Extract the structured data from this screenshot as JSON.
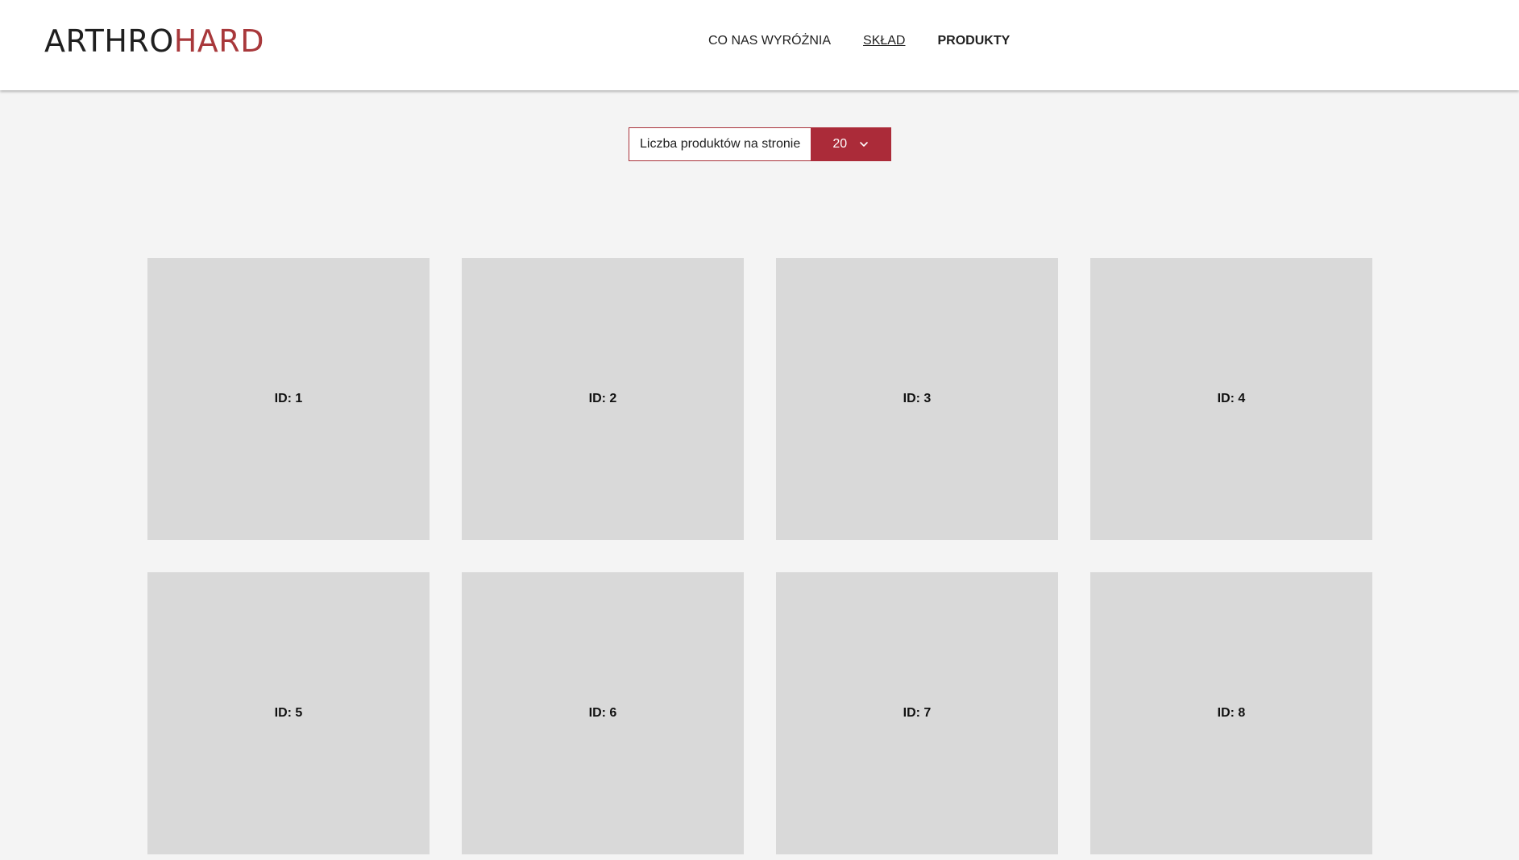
{
  "brand": {
    "logo_part_1": "ARTHRO",
    "logo_part_2": "HARD",
    "accent_color": "#a8383b"
  },
  "nav": {
    "items": [
      {
        "label": "CO NAS WYRÓŻNIA"
      },
      {
        "label": "SKŁAD"
      },
      {
        "label": "PRODUKTY"
      }
    ]
  },
  "per_page": {
    "label": "Liczba produktów na stronie",
    "selected": "20",
    "icon": "chevron-down-icon",
    "button_color": "#ab2b39"
  },
  "products": [
    {
      "label": "ID: 1"
    },
    {
      "label": "ID: 2"
    },
    {
      "label": "ID: 3"
    },
    {
      "label": "ID: 4"
    },
    {
      "label": "ID: 5"
    },
    {
      "label": "ID: 6"
    },
    {
      "label": "ID: 7"
    },
    {
      "label": "ID: 8"
    }
  ]
}
